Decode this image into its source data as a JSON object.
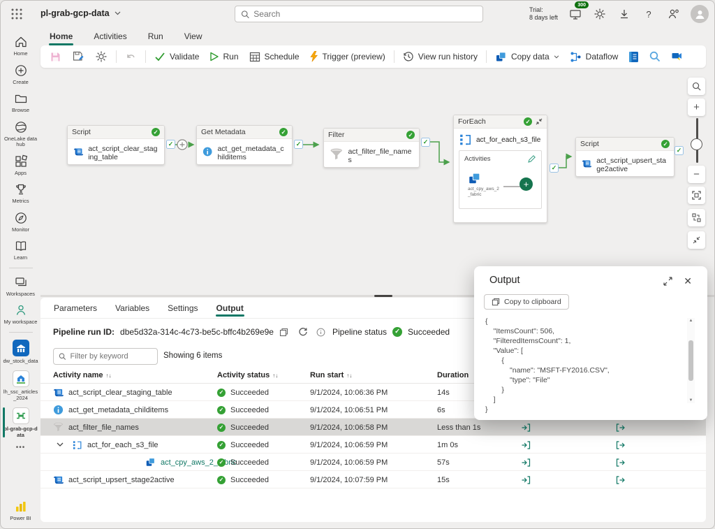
{
  "topbar": {
    "title": "pl-grab-gcp-data",
    "search_placeholder": "Search",
    "trial_line1": "Trial:",
    "trial_line2": "8 days left",
    "badge_count": "300"
  },
  "menu_tabs": {
    "home": "Home",
    "activities": "Activities",
    "run": "Run",
    "view": "View"
  },
  "toolbar": {
    "validate": "Validate",
    "run": "Run",
    "schedule": "Schedule",
    "trigger": "Trigger (preview)",
    "view_run_history": "View run history",
    "copy_data": "Copy data",
    "dataflow": "Dataflow"
  },
  "sidebar": {
    "items": [
      {
        "label": "Home"
      },
      {
        "label": "Create"
      },
      {
        "label": "Browse"
      },
      {
        "label": "OneLake data hub"
      },
      {
        "label": "Apps"
      },
      {
        "label": "Metrics"
      },
      {
        "label": "Monitor"
      },
      {
        "label": "Learn"
      },
      {
        "label": "Workspaces"
      },
      {
        "label": "My workspace"
      },
      {
        "label": "dw_stock_data"
      },
      {
        "label": "lh_ssc_articles_2024"
      },
      {
        "label": "pl-grab-gcp-data"
      },
      {
        "label": "Power BI"
      }
    ],
    "more": "•••"
  },
  "canvas": {
    "nodes": {
      "script1": {
        "type": "Script",
        "name": "act_script_clear_staging_table"
      },
      "get_metadata": {
        "type": "Get Metadata",
        "name": "act_get_metadata_childitems"
      },
      "filter": {
        "type": "Filter",
        "name": "act_filter_file_names"
      },
      "foreach": {
        "type": "ForEach",
        "name": "act_for_each_s3_file",
        "inner_label": "Activities",
        "inner_activity": "act_cpy_aws_2_fabric"
      },
      "script2": {
        "type": "Script",
        "name": "act_script_upsert_stage2active"
      }
    }
  },
  "panel": {
    "tabs": {
      "parameters": "Parameters",
      "variables": "Variables",
      "settings": "Settings",
      "output": "Output"
    },
    "run_id_label": "Pipeline run ID:",
    "run_id": "dbe5d32a-314c-4c73-be5c-bffc4b269e9e",
    "status_label": "Pipeline status",
    "status_value": "Succeeded",
    "filter_placeholder": "Filter by keyword",
    "showing": "Showing 6 items",
    "columns": {
      "name": "Activity name",
      "status": "Activity status",
      "start": "Run start",
      "duration": "Duration"
    },
    "rows": [
      {
        "name": "act_script_clear_staging_table",
        "status": "Succeeded",
        "start": "9/1/2024, 10:06:36 PM",
        "duration": "14s"
      },
      {
        "name": "act_get_metadata_childitems",
        "status": "Succeeded",
        "start": "9/1/2024, 10:06:51 PM",
        "duration": "6s"
      },
      {
        "name": "act_filter_file_names",
        "status": "Succeeded",
        "start": "9/1/2024, 10:06:58 PM",
        "duration": "Less than 1s"
      },
      {
        "name": "act_for_each_s3_file",
        "status": "Succeeded",
        "start": "9/1/2024, 10:06:59 PM",
        "duration": "1m 0s"
      },
      {
        "name": "act_cpy_aws_2_fabric",
        "status": "Succeeded",
        "start": "9/1/2024, 10:06:59 PM",
        "duration": "57s"
      },
      {
        "name": "act_script_upsert_stage2active",
        "status": "Succeeded",
        "start": "9/1/2024, 10:07:59 PM",
        "duration": "15s"
      }
    ]
  },
  "output_popup": {
    "title": "Output",
    "copy_label": "Copy to clipboard",
    "json": "{\n    \"ItemsCount\": 506,\n    \"FilteredItemsCount\": 1,\n    \"Value\": [\n        {\n            \"name\": \"MSFT-FY2016.CSV\",\n            \"type\": \"File\"\n        }\n    ]\n}"
  }
}
